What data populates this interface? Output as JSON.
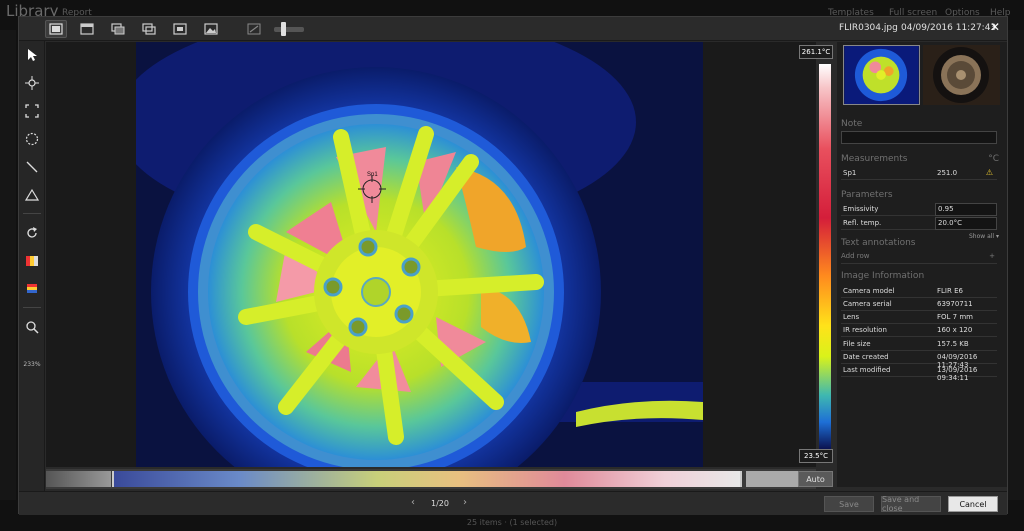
{
  "background": {
    "title": "Library",
    "report": "Report",
    "menu": [
      "Templates",
      "Full screen",
      "Options",
      "Help"
    ],
    "status": "25 items · (1 selected)"
  },
  "topbar": {
    "file_name": "FLIR0304.jpg",
    "file_date": "04/09/2016 11:27:43",
    "close_label": "✕"
  },
  "tools": {
    "zoom_level": "233%"
  },
  "scale": {
    "max": "261.1°C",
    "min": "23.5°C"
  },
  "palette": {
    "auto_label": "Auto"
  },
  "spot": {
    "label": "Sp1"
  },
  "panel": {
    "note_header": "Note",
    "measurements_header": "Measurements",
    "measurements_unit": "°C",
    "measurements": [
      {
        "name": "Sp1",
        "value": "251.0"
      }
    ],
    "parameters_header": "Parameters",
    "parameters": [
      {
        "name": "Emissivity",
        "value": "0.95"
      },
      {
        "name": "Refl. temp.",
        "value": "20.0°C"
      }
    ],
    "show_all": "Show all ▾",
    "text_annotations_header": "Text annotations",
    "add_row": "Add row",
    "add_row_plus": "+",
    "image_info_header": "Image Information",
    "image_info": [
      {
        "name": "Camera model",
        "value": "FLIR E6"
      },
      {
        "name": "Camera serial",
        "value": "63970711"
      },
      {
        "name": "Lens",
        "value": "FOL 7 mm"
      },
      {
        "name": "IR resolution",
        "value": "160 x 120"
      },
      {
        "name": "File size",
        "value": "157.5 KB"
      },
      {
        "name": "Date created",
        "value": "04/09/2016 11:27:43"
      },
      {
        "name": "Last modified",
        "value": "13/09/2016 09:34:11"
      }
    ]
  },
  "footer": {
    "prev": "‹",
    "next": "›",
    "pager": "1/20",
    "save": "Save",
    "save_close": "Save and close",
    "cancel": "Cancel"
  }
}
